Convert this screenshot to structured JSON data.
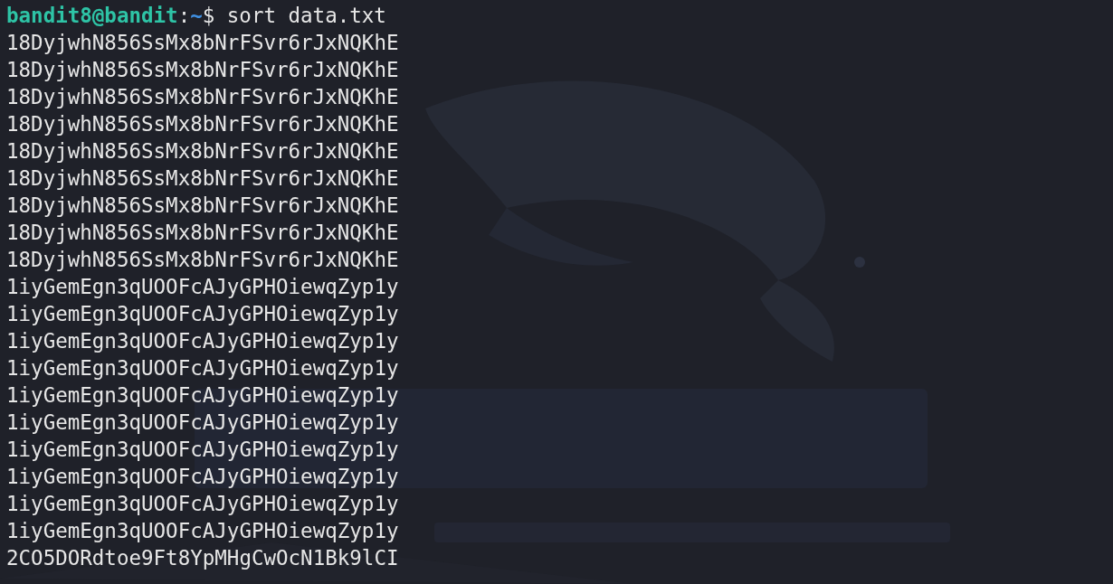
{
  "terminal": {
    "prompt": {
      "user_host": "bandit8@bandit",
      "separator": ":",
      "path": "~",
      "symbol": "$",
      "command": "sort data.txt"
    },
    "output": [
      "18DyjwhN856SsMx8bNrFSvr6rJxNQKhE",
      "18DyjwhN856SsMx8bNrFSvr6rJxNQKhE",
      "18DyjwhN856SsMx8bNrFSvr6rJxNQKhE",
      "18DyjwhN856SsMx8bNrFSvr6rJxNQKhE",
      "18DyjwhN856SsMx8bNrFSvr6rJxNQKhE",
      "18DyjwhN856SsMx8bNrFSvr6rJxNQKhE",
      "18DyjwhN856SsMx8bNrFSvr6rJxNQKhE",
      "18DyjwhN856SsMx8bNrFSvr6rJxNQKhE",
      "18DyjwhN856SsMx8bNrFSvr6rJxNQKhE",
      "1iyGemEgn3qUOOFcAJyGPHOiewqZyp1y",
      "1iyGemEgn3qUOOFcAJyGPHOiewqZyp1y",
      "1iyGemEgn3qUOOFcAJyGPHOiewqZyp1y",
      "1iyGemEgn3qUOOFcAJyGPHOiewqZyp1y",
      "1iyGemEgn3qUOOFcAJyGPHOiewqZyp1y",
      "1iyGemEgn3qUOOFcAJyGPHOiewqZyp1y",
      "1iyGemEgn3qUOOFcAJyGPHOiewqZyp1y",
      "1iyGemEgn3qUOOFcAJyGPHOiewqZyp1y",
      "1iyGemEgn3qUOOFcAJyGPHOiewqZyp1y",
      "1iyGemEgn3qUOOFcAJyGPHOiewqZyp1y",
      "2CO5DORdtoe9Ft8YpMHgCwOcN1Bk9lCI"
    ]
  }
}
